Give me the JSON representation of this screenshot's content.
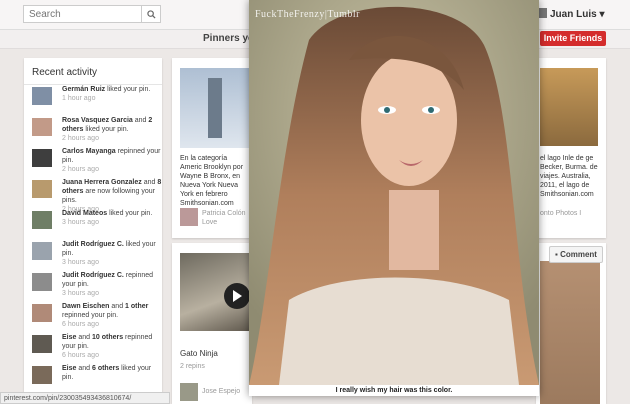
{
  "topbar": {
    "search_placeholder": "Search",
    "user_name": "Juan Luis ▾"
  },
  "subbar": {
    "pinners_text": "Pinners you",
    "invite_label": "Invite Friends"
  },
  "recent": {
    "title": "Recent activity",
    "items": [
      {
        "html": "<b>Germán Ruiz</b> liked your pin.",
        "time": "1 hour ago"
      },
      {
        "html": "<b>Rosa Vasquez Garcia</b> and <b>2 others</b> liked your pin.",
        "time": "2 hours ago"
      },
      {
        "html": "<b>Carlos Mayanga</b> repinned your pin.",
        "time": "2 hours ago"
      },
      {
        "html": "<b>Juana Herrera Gonzalez</b> and <b>8 others</b> are now following your pins.",
        "time": "2 hours ago"
      },
      {
        "html": "<b>David Mateos</b> liked your pin.",
        "time": "3 hours ago"
      },
      {
        "html": "<b>Judit Rodríguez C.</b> liked your pin.",
        "time": "3 hours ago"
      },
      {
        "html": "<b>Judit Rodríguez C.</b> repinned your pin.",
        "time": "3 hours ago"
      },
      {
        "html": "<b>Dawn Eischen</b> and <b>1 other</b> repinned your pin.",
        "time": "6 hours ago"
      },
      {
        "html": "<b>Eise</b> and <b>10 others</b> repinned your pin.",
        "time": "6 hours ago"
      },
      {
        "html": "<b>Eise</b> and <b>6 others</b> liked your pin.",
        "time": ""
      }
    ]
  },
  "card1": {
    "text": "En la categoría Americ Brooklyn por Wayne B Bronx, en Nueva York Nueva York en febrero Smithsonian.com",
    "pinner": "Patricia Colón",
    "sub": "Love"
  },
  "card2": {
    "title": "Gato Ninja",
    "repins": "2 repins",
    "pinner": "Jose Espejo"
  },
  "card3": {
    "text": "el lago Inle de ge Becker, Burma. de viajes. Australia, 2011, el lago de Smithsonian.com",
    "onto": "onto Photos I"
  },
  "comment_label": "Comment",
  "overlay": {
    "watermark": "FuckTheFrenzy|Tumblr",
    "caption": "I really wish my hair was this color."
  },
  "status_url": "pinterest.com/pin/230035493436810674/"
}
